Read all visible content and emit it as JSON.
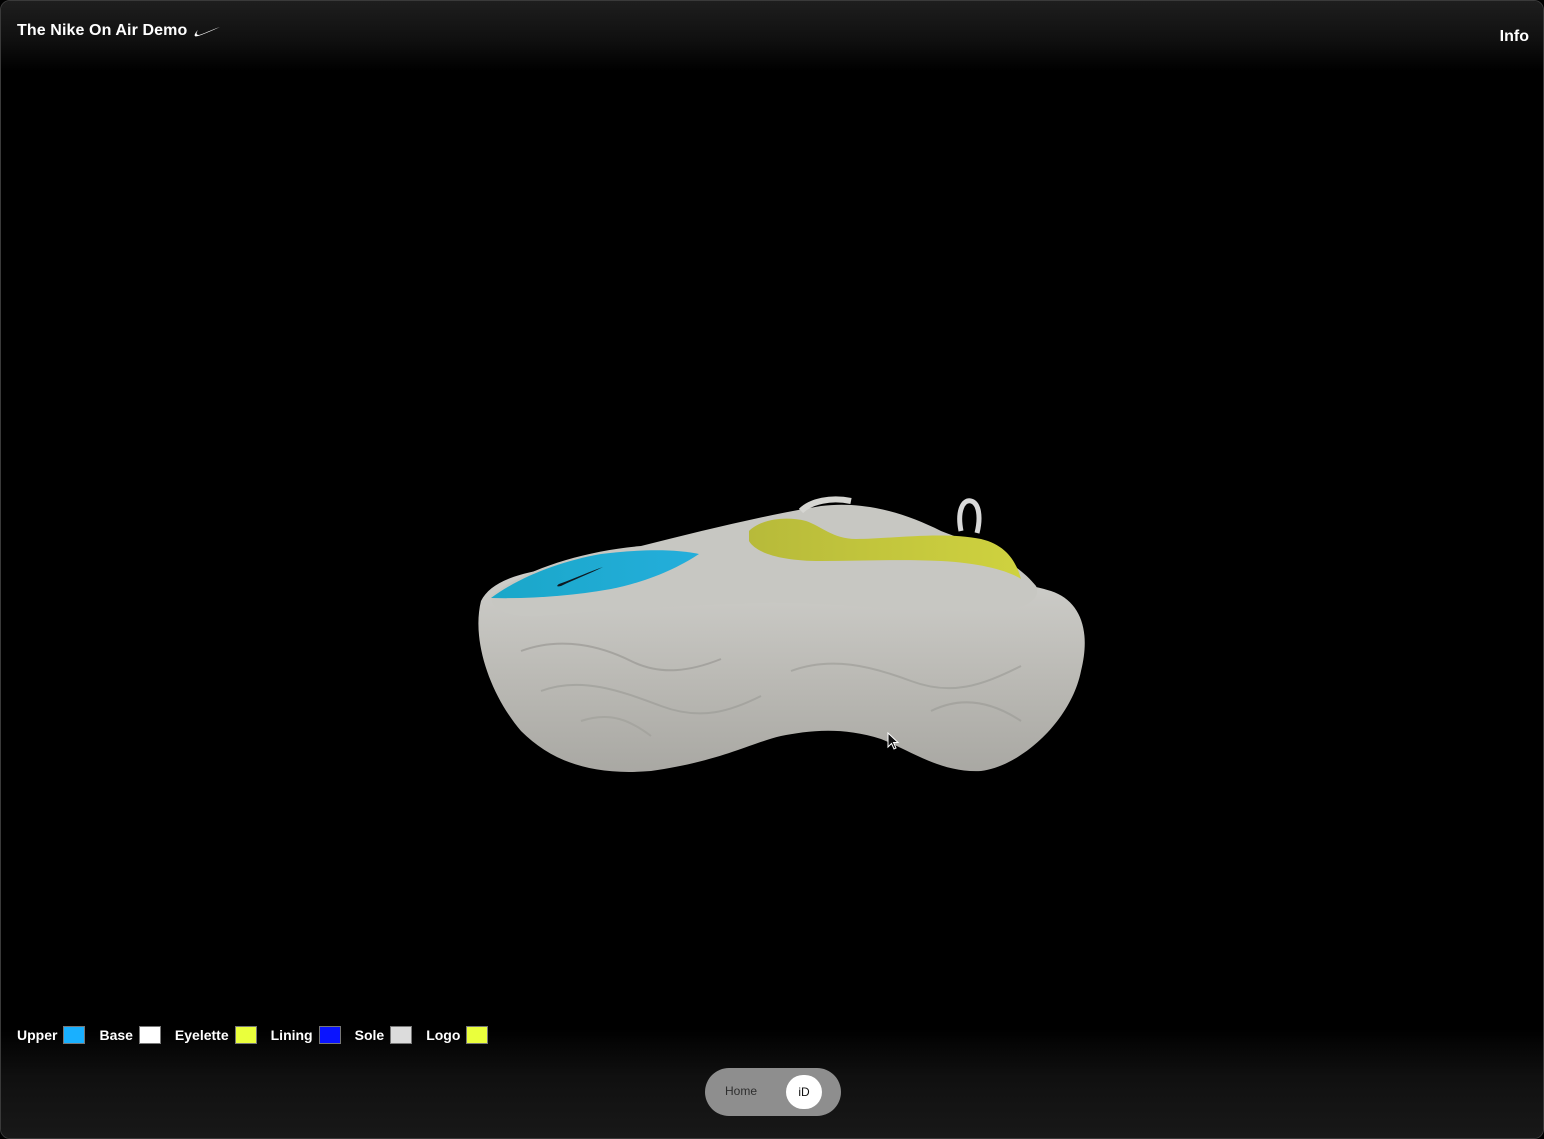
{
  "header": {
    "title": "The Nike On Air Demo",
    "logo_icon": "nike-swoosh-icon",
    "info_label": "Info"
  },
  "viewport": {
    "content": "3d-shoe-model"
  },
  "palette": {
    "items": [
      {
        "label": "Upper",
        "color": "#19b0ff"
      },
      {
        "label": "Base",
        "color": "#ffffff"
      },
      {
        "label": "Eyelette",
        "color": "#eaff3c"
      },
      {
        "label": "Lining",
        "color": "#0a14ff"
      },
      {
        "label": "Sole",
        "color": "#dcdcdc"
      },
      {
        "label": "Logo",
        "color": "#eaff3c"
      }
    ]
  },
  "mode_toggle": {
    "home_label": "Home",
    "id_label": "iD",
    "selected": "iD"
  }
}
